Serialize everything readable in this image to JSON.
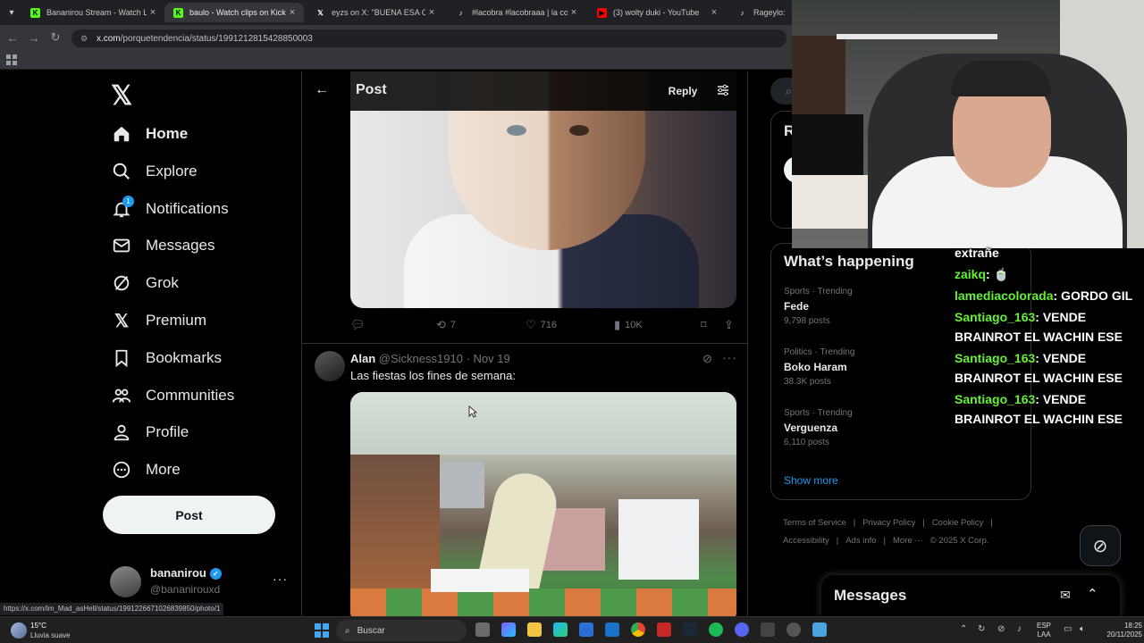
{
  "browser": {
    "tabs": [
      {
        "title": "Bananirou Stream - Watch Live",
        "favicon_color": "#53fc18",
        "favicon_glyph": "K",
        "active": false
      },
      {
        "title": "baulo - Watch clips on Kick",
        "favicon_color": "#53fc18",
        "favicon_glyph": "K",
        "active": true
      },
      {
        "title": "eyzs on X: \"BUENA ESA COMPA",
        "favicon_color": "#ffffff",
        "favicon_glyph": "𝕏",
        "active": false
      },
      {
        "title": "#lacobra #lacobraaa | la cobra",
        "favicon_color": "#ffffff",
        "favicon_glyph": "♪",
        "active": false
      },
      {
        "title": "(3) wolty duki - YouTube",
        "favicon_color": "#ff0000",
        "favicon_glyph": "▶",
        "active": false
      },
      {
        "title": "Rageylo: Alon",
        "favicon_color": "#ffffff",
        "favicon_glyph": "♪",
        "active": false
      }
    ],
    "url_host": "x.com",
    "url_path": "/porquetendencia/status/1991212815428850003",
    "status_url": "https://x.com/Im_Mad_asHell/status/1991226671026839850/photo/1"
  },
  "x": {
    "logo": "𝕏",
    "nav": [
      {
        "label": "Home",
        "icon": "home-icon"
      },
      {
        "label": "Explore",
        "icon": "search-icon"
      },
      {
        "label": "Notifications",
        "icon": "bell-icon"
      },
      {
        "label": "Messages",
        "icon": "envelope-icon"
      },
      {
        "label": "Grok",
        "icon": "grok-icon"
      },
      {
        "label": "Premium",
        "icon": "x-premium-icon"
      },
      {
        "label": "Bookmarks",
        "icon": "bookmark-icon"
      },
      {
        "label": "Communities",
        "icon": "communities-icon"
      },
      {
        "label": "Profile",
        "icon": "person-icon"
      },
      {
        "label": "More",
        "icon": "more-circle-icon"
      }
    ],
    "notifications_badge": "1",
    "post_button": "Post",
    "account": {
      "name": "bananirou",
      "handle": "@bananirouxd"
    }
  },
  "center": {
    "header_title": "Post",
    "reply_label": "Reply",
    "tweet1_actions": {
      "replies": "",
      "retweets": "7",
      "likes": "716",
      "views": "10K"
    },
    "tweet2": {
      "name": "Alan",
      "handle": "@Sickness1910",
      "date": "Nov 19",
      "text": "Las fiestas los fines de semana:"
    }
  },
  "right": {
    "upper_partial_letter": "R",
    "whats_happening": "What’s happening",
    "trends": [
      {
        "category": "Sports · Trending",
        "title": "Fede",
        "posts": "9,798 posts"
      },
      {
        "category": "Politics · Trending",
        "title": "Boko Haram",
        "posts": "38.3K posts"
      },
      {
        "category": "Sports · Trending",
        "title": "Verguenza",
        "posts": "6,110 posts"
      }
    ],
    "show_more": "Show more",
    "footer": [
      "Terms of Service",
      "|",
      "Privacy Policy",
      "|",
      "Cookie Policy",
      "|",
      "Accessibility",
      "|",
      "Ads info",
      "|",
      "More ···",
      "© 2025 X Corp."
    ],
    "messages_title": "Messages"
  },
  "chat": {
    "lines": [
      {
        "user": "",
        "text": "extrañe"
      },
      {
        "user": "zaikq",
        "text": ": 🍵"
      },
      {
        "user": "lamediacolorada",
        "text": ": GORDO GIL"
      },
      {
        "user": "Santiago_163",
        "text": ": VENDE BRAINROT EL WACHIN ESE"
      },
      {
        "user": "Santiago_163",
        "text": ": VENDE BRAINROT EL WACHIN ESE"
      },
      {
        "user": "Santiago_163",
        "text": ": VENDE BRAINROT EL WACHIN ESE"
      }
    ]
  },
  "taskbar": {
    "weather_temp": "15°C",
    "weather_desc": "Lluvia suave",
    "search_placeholder": "Buscar",
    "lang1": "ESP",
    "lang2": "LAA",
    "time": "18:25",
    "date": "20/11/2025"
  },
  "colors": {
    "accent": "#1d9bf0",
    "chat_user": "#67f03a",
    "kick": "#53fc18"
  }
}
